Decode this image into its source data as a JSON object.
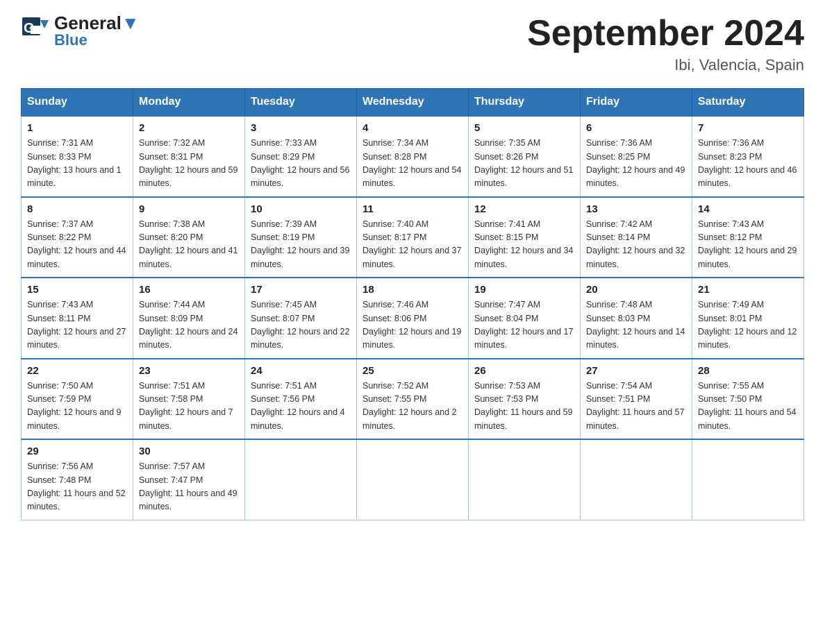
{
  "header": {
    "logo_general": "General",
    "logo_blue": "Blue",
    "main_title": "September 2024",
    "subtitle": "Ibi, Valencia, Spain"
  },
  "calendar": {
    "days_of_week": [
      "Sunday",
      "Monday",
      "Tuesday",
      "Wednesday",
      "Thursday",
      "Friday",
      "Saturday"
    ],
    "weeks": [
      [
        {
          "day": "1",
          "sunrise": "7:31 AM",
          "sunset": "8:33 PM",
          "daylight": "13 hours and 1 minute."
        },
        {
          "day": "2",
          "sunrise": "7:32 AM",
          "sunset": "8:31 PM",
          "daylight": "12 hours and 59 minutes."
        },
        {
          "day": "3",
          "sunrise": "7:33 AM",
          "sunset": "8:29 PM",
          "daylight": "12 hours and 56 minutes."
        },
        {
          "day": "4",
          "sunrise": "7:34 AM",
          "sunset": "8:28 PM",
          "daylight": "12 hours and 54 minutes."
        },
        {
          "day": "5",
          "sunrise": "7:35 AM",
          "sunset": "8:26 PM",
          "daylight": "12 hours and 51 minutes."
        },
        {
          "day": "6",
          "sunrise": "7:36 AM",
          "sunset": "8:25 PM",
          "daylight": "12 hours and 49 minutes."
        },
        {
          "day": "7",
          "sunrise": "7:36 AM",
          "sunset": "8:23 PM",
          "daylight": "12 hours and 46 minutes."
        }
      ],
      [
        {
          "day": "8",
          "sunrise": "7:37 AM",
          "sunset": "8:22 PM",
          "daylight": "12 hours and 44 minutes."
        },
        {
          "day": "9",
          "sunrise": "7:38 AM",
          "sunset": "8:20 PM",
          "daylight": "12 hours and 41 minutes."
        },
        {
          "day": "10",
          "sunrise": "7:39 AM",
          "sunset": "8:19 PM",
          "daylight": "12 hours and 39 minutes."
        },
        {
          "day": "11",
          "sunrise": "7:40 AM",
          "sunset": "8:17 PM",
          "daylight": "12 hours and 37 minutes."
        },
        {
          "day": "12",
          "sunrise": "7:41 AM",
          "sunset": "8:15 PM",
          "daylight": "12 hours and 34 minutes."
        },
        {
          "day": "13",
          "sunrise": "7:42 AM",
          "sunset": "8:14 PM",
          "daylight": "12 hours and 32 minutes."
        },
        {
          "day": "14",
          "sunrise": "7:43 AM",
          "sunset": "8:12 PM",
          "daylight": "12 hours and 29 minutes."
        }
      ],
      [
        {
          "day": "15",
          "sunrise": "7:43 AM",
          "sunset": "8:11 PM",
          "daylight": "12 hours and 27 minutes."
        },
        {
          "day": "16",
          "sunrise": "7:44 AM",
          "sunset": "8:09 PM",
          "daylight": "12 hours and 24 minutes."
        },
        {
          "day": "17",
          "sunrise": "7:45 AM",
          "sunset": "8:07 PM",
          "daylight": "12 hours and 22 minutes."
        },
        {
          "day": "18",
          "sunrise": "7:46 AM",
          "sunset": "8:06 PM",
          "daylight": "12 hours and 19 minutes."
        },
        {
          "day": "19",
          "sunrise": "7:47 AM",
          "sunset": "8:04 PM",
          "daylight": "12 hours and 17 minutes."
        },
        {
          "day": "20",
          "sunrise": "7:48 AM",
          "sunset": "8:03 PM",
          "daylight": "12 hours and 14 minutes."
        },
        {
          "day": "21",
          "sunrise": "7:49 AM",
          "sunset": "8:01 PM",
          "daylight": "12 hours and 12 minutes."
        }
      ],
      [
        {
          "day": "22",
          "sunrise": "7:50 AM",
          "sunset": "7:59 PM",
          "daylight": "12 hours and 9 minutes."
        },
        {
          "day": "23",
          "sunrise": "7:51 AM",
          "sunset": "7:58 PM",
          "daylight": "12 hours and 7 minutes."
        },
        {
          "day": "24",
          "sunrise": "7:51 AM",
          "sunset": "7:56 PM",
          "daylight": "12 hours and 4 minutes."
        },
        {
          "day": "25",
          "sunrise": "7:52 AM",
          "sunset": "7:55 PM",
          "daylight": "12 hours and 2 minutes."
        },
        {
          "day": "26",
          "sunrise": "7:53 AM",
          "sunset": "7:53 PM",
          "daylight": "11 hours and 59 minutes."
        },
        {
          "day": "27",
          "sunrise": "7:54 AM",
          "sunset": "7:51 PM",
          "daylight": "11 hours and 57 minutes."
        },
        {
          "day": "28",
          "sunrise": "7:55 AM",
          "sunset": "7:50 PM",
          "daylight": "11 hours and 54 minutes."
        }
      ],
      [
        {
          "day": "29",
          "sunrise": "7:56 AM",
          "sunset": "7:48 PM",
          "daylight": "11 hours and 52 minutes."
        },
        {
          "day": "30",
          "sunrise": "7:57 AM",
          "sunset": "7:47 PM",
          "daylight": "11 hours and 49 minutes."
        },
        null,
        null,
        null,
        null,
        null
      ]
    ],
    "sunrise_label": "Sunrise: ",
    "sunset_label": "Sunset: ",
    "daylight_label": "Daylight: "
  }
}
